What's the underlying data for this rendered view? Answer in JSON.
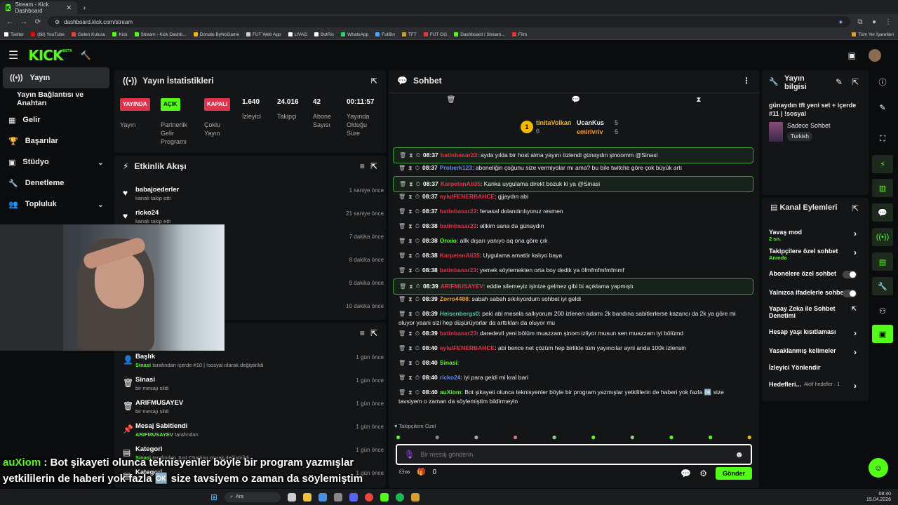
{
  "browser": {
    "tabs": [
      {
        "label": "Stream - Kick Dashboard"
      },
      {
        "label": "+"
      }
    ],
    "url": "dashboard.kick.com/stream",
    "bookmarks": [
      "Twitter",
      "(88) YouTube",
      "Gelen Kutusu",
      "Kick",
      "Stream - Kick Dashb...",
      "Donate ByNoGame",
      "FUT Web App",
      "LIVAD",
      "BotRix",
      "WhatsApp",
      "FutBin",
      "TFT",
      "FUT GG",
      "Dashboard / Stream...",
      "Film"
    ],
    "all_bookmarks": "Tüm Yer İşaretleri"
  },
  "app": {
    "logo": "KICK",
    "logo_tag": "BETA"
  },
  "sidebar": {
    "items": [
      {
        "label": "Yayın"
      },
      {
        "label": "Yayın Bağlantısı ve Anahtarı"
      },
      {
        "label": "Gelir"
      },
      {
        "label": "Başarılar"
      },
      {
        "label": "Stüdyo"
      },
      {
        "label": "Denetleme"
      },
      {
        "label": "Topluluk"
      }
    ]
  },
  "stats": {
    "title": "Yayın İstatistikleri",
    "cols": [
      {
        "badge": "YAYINDA",
        "label": "Yayın"
      },
      {
        "badge": "AÇIK",
        "label": "Partnerlik Gelir Programı"
      },
      {
        "badge": "KAPALI",
        "label": "Çoklu Yayın"
      },
      {
        "value": "1.640",
        "label": "İzleyici"
      },
      {
        "value": "24.016",
        "label": "Takipçi"
      },
      {
        "value": "42",
        "label": "Abone Sayısı"
      },
      {
        "value": "00:11:57",
        "label": "Yayında Olduğu Süre"
      }
    ]
  },
  "activity": {
    "title": "Etkinlik Akışı",
    "items": [
      {
        "name": "babajoederler",
        "sub": "kanalı takip etti",
        "time": "1 saniye önce"
      },
      {
        "name": "ricko24",
        "sub": "kanalı takip etti",
        "time": "21 saniye önce"
      },
      {
        "name": "",
        "sub": "",
        "time": "7 dakika önce"
      },
      {
        "name": "",
        "sub": "",
        "time": "8 dakika önce"
      },
      {
        "name": "",
        "sub": "",
        "time": "9 dakika önce"
      },
      {
        "name": "",
        "sub": "",
        "time": "10 dakika önce"
      }
    ]
  },
  "modlog": {
    "items": [
      {
        "name": "Başlık",
        "sub_user": "Sinasi",
        "sub": "tarafından içerde #10 | !sosyal olarak değiştirildi",
        "time": "1 gün önce"
      },
      {
        "name": "Sinasi",
        "sub": "bir mesajı sildi",
        "time": "1 gün önce"
      },
      {
        "name": "ARIFMUSAYEV",
        "sub": "bir mesajı sildi",
        "time": "1 gün önce"
      },
      {
        "name": "Mesaj Sabitlendi",
        "sub_user": "ARIFMUSAYEV",
        "sub": "tarafından",
        "time": "1 gün önce"
      },
      {
        "name": "Kategori",
        "sub_user": "Sinasi",
        "sub": "tarafından Just Chatting olarak değiştirildi",
        "time": "1 gün önce"
      },
      {
        "name": "Kategori",
        "sub": "",
        "time": "1 gün önce"
      }
    ]
  },
  "chat": {
    "title": "Sohbet",
    "top_users": [
      {
        "name": "tinitaVolkan",
        "count": "6"
      },
      {
        "name": "UcanKus",
        "count": "5"
      },
      {
        "name": "emirivriv",
        "count": "5"
      }
    ],
    "messages": [
      {
        "time": "08:37",
        "user": "batinbasar23",
        "color": "#e0324b",
        "text": ": ayda yılda bir host alma yayını özlendi günaydın şinoomm @Sinasi",
        "hl": true
      },
      {
        "time": "08:37",
        "user": "Proberk123",
        "color": "#5b8bff",
        "text": ": aboneliğin çoğunu size vermiyolar mı ama? bu bile twitche göre çok büyük artı",
        "hl": false
      },
      {
        "time": "08:37",
        "user": "KarpetenAli35",
        "color": "#e0324b",
        "text": ": Kanka uygulama direkt bozuk ki ya @Sinasi",
        "hl": true
      },
      {
        "time": "08:37",
        "user": "eylulFENERBAHCE",
        "color": "#e0324b",
        "text": ": gjjaydın abi",
        "hl": false
      },
      {
        "time": "08:37",
        "user": "batinbasar23",
        "color": "#e0324b",
        "text": ": fenasal dolandırılıyoruz resmen",
        "hl": false
      },
      {
        "time": "08:38",
        "user": "batinbasar23",
        "color": "#e0324b",
        "text": ": allkim sana da günaydın",
        "hl": false
      },
      {
        "time": "08:38",
        "user": "Onxio",
        "color": "#53fc18",
        "text": ": allk dışarı yanıyo aq ona göre çık",
        "hl": false
      },
      {
        "time": "08:38",
        "user": "KarpetenAli35",
        "color": "#e0324b",
        "text": ": Uygulama amatör kalıyo baya",
        "hl": false
      },
      {
        "time": "08:38",
        "user": "batinbasar23",
        "color": "#e0324b",
        "text": ": yemek söylemekten orta boy dedik ya öfmfmfmfmfmmf",
        "hl": false
      },
      {
        "time": "08:39",
        "user": "ARIFMUSAYEV",
        "color": "#e0324b",
        "text": ": eddie silemeyiz işinize gelmez gibi bi açıklama yapmıştı",
        "hl": true
      },
      {
        "time": "08:39",
        "user": "Zorro4488",
        "color": "#f0a030",
        "text": ": sabah sabah sıkılıyordum sohbet iyi geldi",
        "hl": false
      },
      {
        "time": "08:39",
        "user": "Heisenbergs0",
        "color": "#4cc9a0",
        "text": ": peki abi mesela sallıyorum 200 izlenen adamı 2k bandına sabitlerlerse kazancı da 2k ya göre mi oluyor yaani sizi hep düşürüyorlar da arttıkları da oluyor mu",
        "hl": false
      },
      {
        "time": "08:39",
        "user": "batinbasar23",
        "color": "#e0324b",
        "text": ": daredevil yeni bölüm muazzam şinom izliyor musun sen muazzam iyi bölümd",
        "hl": false
      },
      {
        "time": "08:40",
        "user": "eylulFENERBAHCE",
        "color": "#e0324b",
        "text": ": abi bence net çözüm hep birlikte tüm yayıncılar ayni anda 100k izlensin",
        "hl": false
      },
      {
        "time": "08:40",
        "user": "Sinasi",
        "color": "#53fc18",
        "text": ":",
        "hl": false
      },
      {
        "time": "08:40",
        "user": "ricko24",
        "color": "#5b8bff",
        "text": ": iyi para geldi mi kral bari",
        "hl": false
      },
      {
        "time": "08:40",
        "user": "auXiom",
        "color": "#53fc18",
        "text": ": Bot şikayeti olunca teknisyenler böyle bir program yazmışlar yetkililerin de haberi yok fazla 🆗 size tavsiyem o zaman da söylemiştim bildirmeyin",
        "hl": false
      }
    ],
    "followers_only": "Takipçilere Özel",
    "input_placeholder": "Bir mesaj gönderin",
    "points": "0",
    "send_label": "Gönder"
  },
  "stream_info": {
    "title": "Yayın bilgisi",
    "stream_title": "günaydın tft yeni set + içerde #11 | !sosyal",
    "category": "Sadece Sohbet",
    "language": "Turkish"
  },
  "channel_actions": {
    "title": "Kanal Eylemleri",
    "rows": [
      {
        "label": "Yavaş mod",
        "sub": "2 sn."
      },
      {
        "label": "Takipçilere özel sohbet",
        "sub": "Anında"
      },
      {
        "label": "Abonelere özel sohbet",
        "sub": ""
      },
      {
        "label": "Yalnızca ifadelerle sohbet",
        "sub": ""
      },
      {
        "label": "Yapay Zeka ile Sohbet Denetimi",
        "sub": ""
      },
      {
        "label": "Hesap yaşı kısıtlaması",
        "sub": ""
      },
      {
        "label": "Yasaklanmış kelimeler",
        "sub": ""
      },
      {
        "label": "İzleyici Yönlendir",
        "sub": ""
      },
      {
        "label": "Hedefleri...",
        "sub": "Aktif hedefler · 1"
      }
    ]
  },
  "overlay": {
    "user": "auXiom",
    "text": " : Bot şikayeti olunca teknisyenler böyle bir program yazmışlar yetkililerin de haberi yok fazla 🆗 size tavsiyem o zaman da söylemiştim bildirmeyin"
  },
  "taskbar": {
    "search": "Ara",
    "time": "08:40",
    "date": "15.04.2026"
  }
}
